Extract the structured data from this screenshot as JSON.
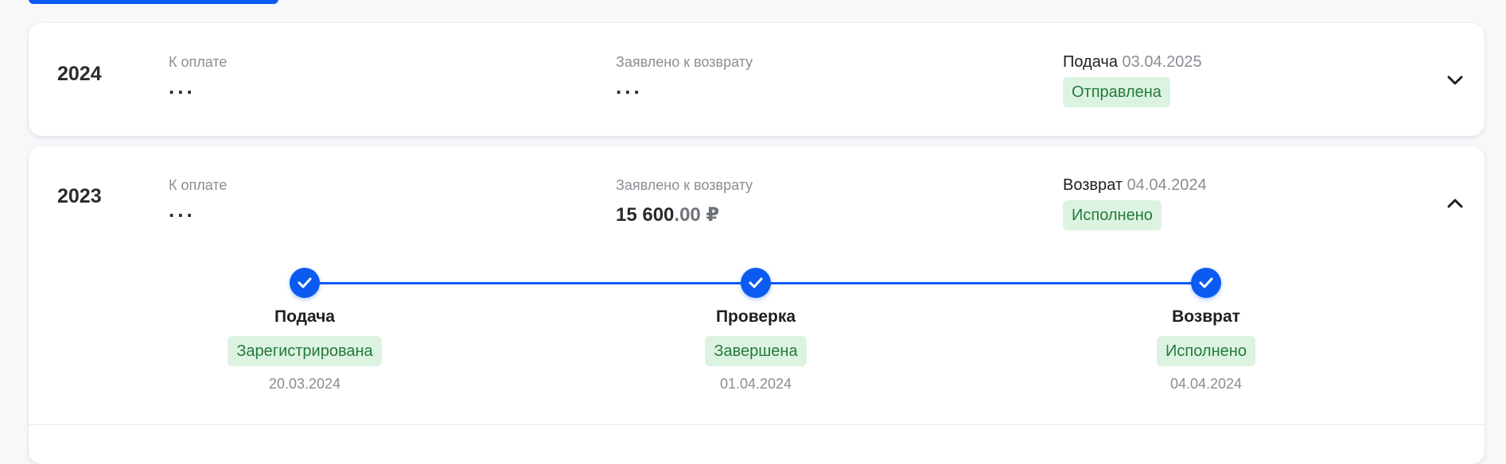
{
  "cards": [
    {
      "year": "2024",
      "payment_label": "К оплате",
      "payment_value": "...",
      "refund_label": "Заявлено к возврату",
      "refund_value": "...",
      "stage_name": "Подача",
      "stage_date": "03.04.2025",
      "status": "Отправлена",
      "expanded": false
    },
    {
      "year": "2023",
      "payment_label": "К оплате",
      "payment_value": "...",
      "refund_label": "Заявлено к возврату",
      "refund_amount_main": "15 600",
      "refund_amount_frac": ".00 ₽",
      "stage_name": "Возврат",
      "stage_date": "04.04.2024",
      "status": "Исполнено",
      "expanded": true,
      "steps": [
        {
          "title": "Подача",
          "status": "Зарегистрирована",
          "date": "20.03.2024"
        },
        {
          "title": "Проверка",
          "status": "Завершена",
          "date": "01.04.2024"
        },
        {
          "title": "Возврат",
          "status": "Исполнено",
          "date": "04.04.2024"
        }
      ]
    }
  ],
  "icons": {
    "expand": "chevron-down-icon",
    "collapse": "chevron-up-icon",
    "step_done": "check-icon"
  },
  "colors": {
    "accent": "#0b5bf0",
    "badge_bg": "#ddf3e2",
    "badge_text": "#237a3a"
  }
}
